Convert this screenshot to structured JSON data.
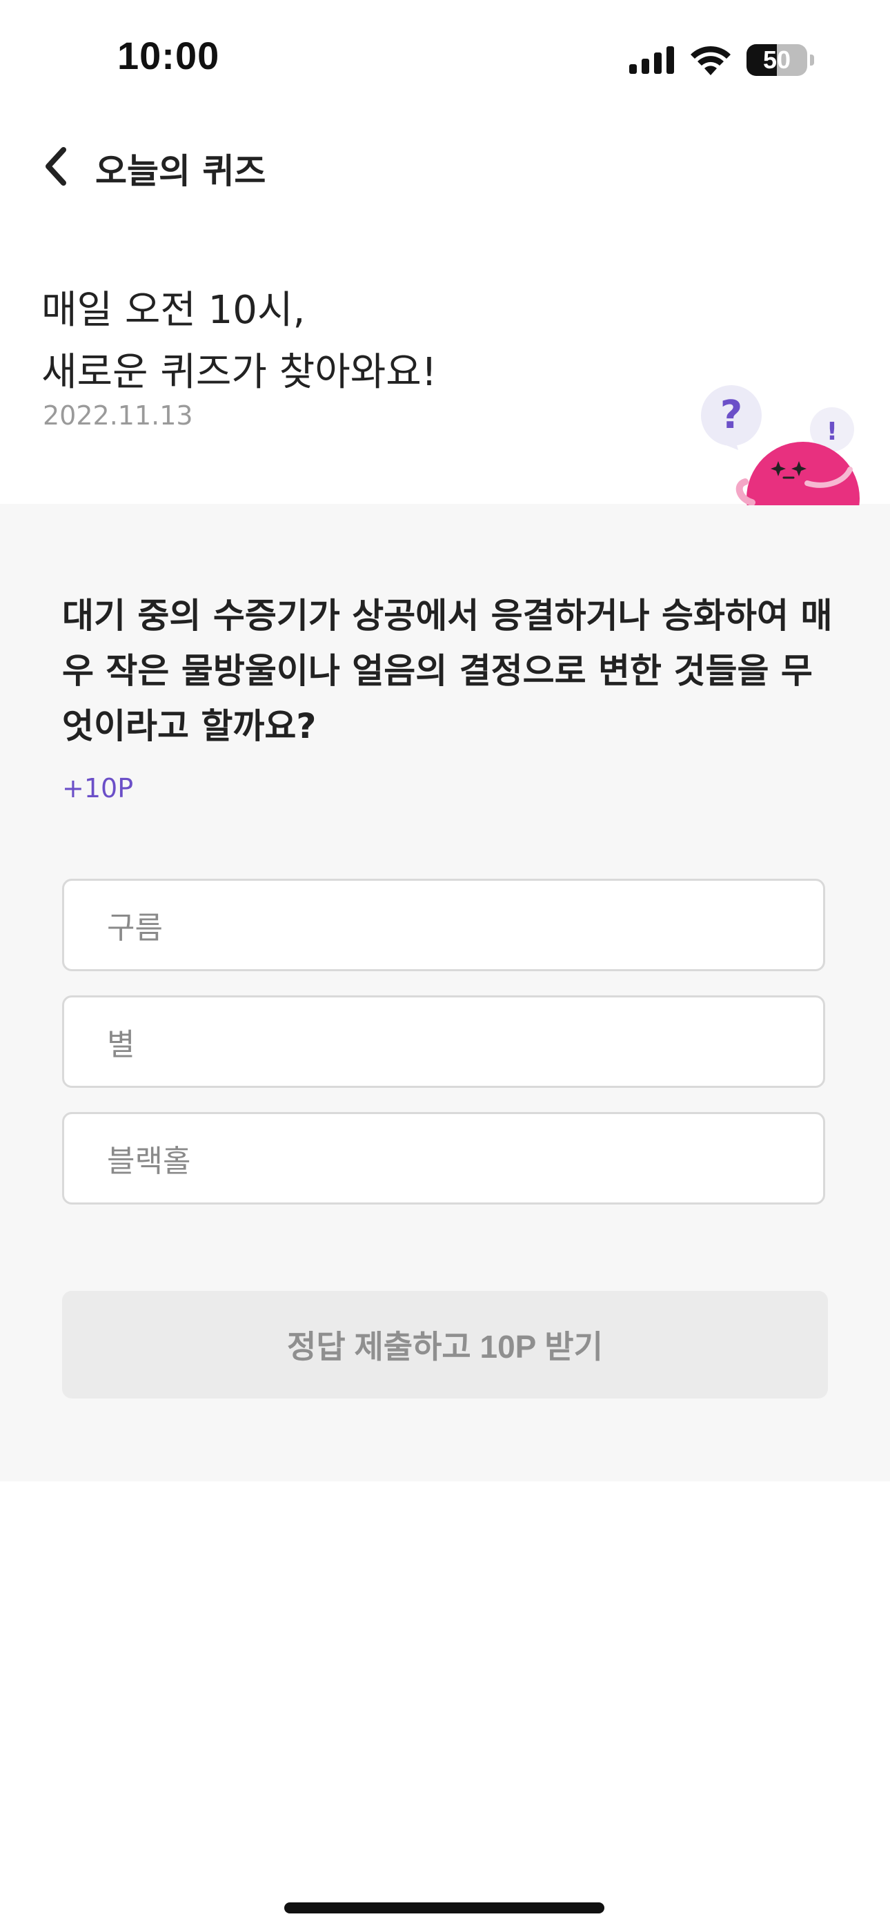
{
  "status_bar": {
    "time": "10:00",
    "battery_level": "50"
  },
  "header": {
    "back_icon": "chevron-left-icon",
    "title": "오늘의 퀴즈"
  },
  "intro": {
    "line1": "매일 오전 10시,",
    "line2": "새로운 퀴즈가 찾아와요!",
    "date": "2022.11.13"
  },
  "mascot": {
    "bubble_left": "?",
    "bubble_right": "!"
  },
  "quiz": {
    "question": "대기 중의 수증기가 상공에서 응결하거나 승화하여 매우 작은 물방울이나 얼음의 결정으로 변한 것들을 무엇이라고 할까요?",
    "points": "+10P",
    "options": [
      {
        "label": "구름"
      },
      {
        "label": "별"
      },
      {
        "label": "블랙홀"
      }
    ],
    "submit_label": "정답 제출하고 10P 받기"
  },
  "colors": {
    "accent": "#6b4fc8",
    "mascot_pink": "#e8307f",
    "section_bg": "#f7f7f7"
  }
}
